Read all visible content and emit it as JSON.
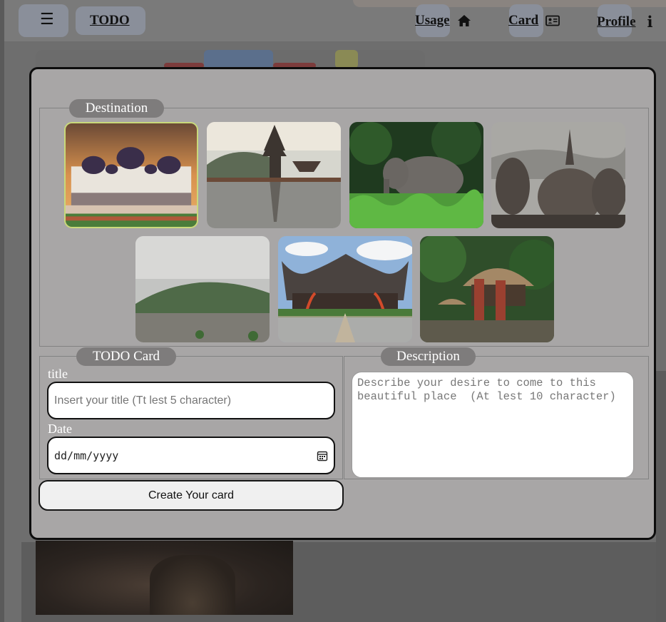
{
  "nav": {
    "menu_icon": "hamburger-menu-icon",
    "brand": "TODO",
    "links": [
      {
        "label": "Usage",
        "icon": "home-icon"
      },
      {
        "label": "Card",
        "icon": "id-card-icon"
      },
      {
        "label": "Profile",
        "icon": "info-icon"
      }
    ]
  },
  "modal": {
    "destination": {
      "legend": "Destination",
      "images": [
        {
          "name": "grand-mosque",
          "selected": true
        },
        {
          "name": "lake-temple"
        },
        {
          "name": "elephant-jungle"
        },
        {
          "name": "stupa-temple"
        },
        {
          "name": "volcano-plain"
        },
        {
          "name": "traditional-house"
        },
        {
          "name": "hut-village"
        }
      ]
    },
    "todo_card": {
      "legend": "TODO Card",
      "title_label": "title",
      "title_placeholder": "Insert your title (Tt lest 5 character)",
      "title_value": "",
      "date_label": "Date",
      "date_placeholder": "dd/mm/yyyy"
    },
    "description": {
      "legend": "Description",
      "placeholder": "Describe your desire to come to this beautiful place  (At lest 10 character)"
    },
    "create_button": "Create Your card"
  },
  "colors": {
    "modal_bg": "#a8a6a6",
    "legend_pill": "#7e7c7c",
    "selected_border": "#c9d97a"
  }
}
